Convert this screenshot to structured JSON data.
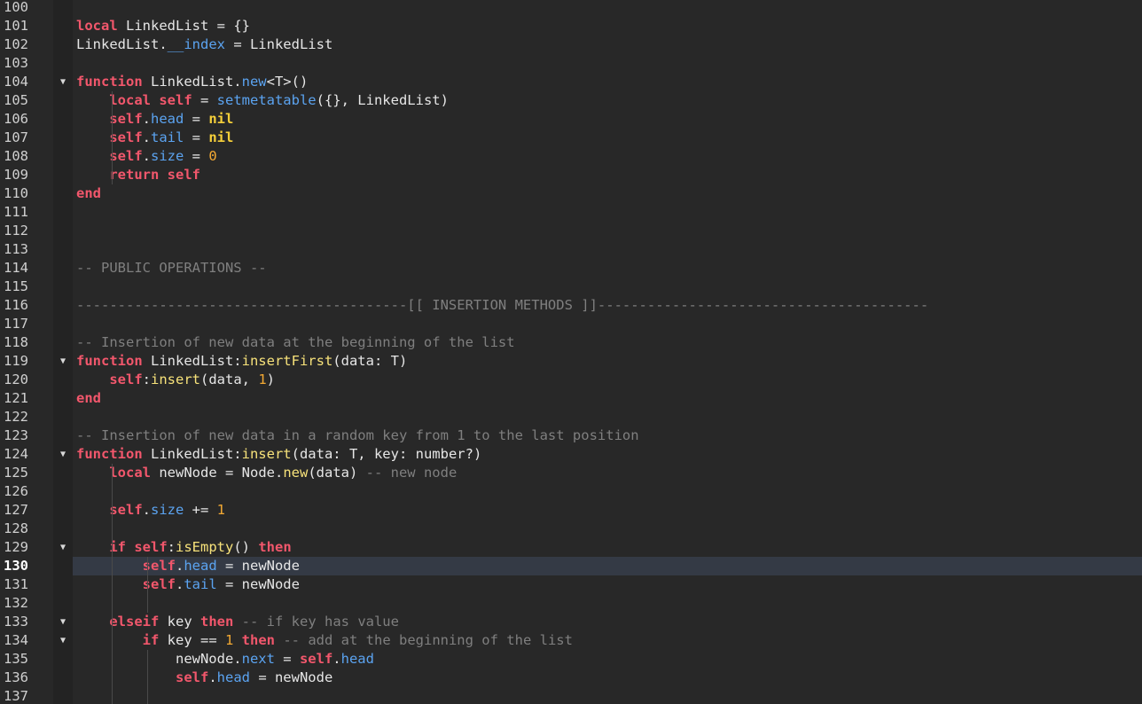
{
  "editor": {
    "first_line": 100,
    "active_line": 130,
    "fold_marker_icon": "fold-caret-icon",
    "colors": {
      "background": "#282828",
      "keyword": "#f2576c",
      "comment": "#7f7f7f",
      "function": "#f7e27a",
      "property": "#5ba3f0",
      "number": "#f3a933",
      "constant": "#f5cf3a",
      "text": "#e6e6e6",
      "active_line": "#343a45"
    },
    "lines": [
      {
        "num": "100",
        "fold": false,
        "tokens": []
      },
      {
        "num": "101",
        "fold": false,
        "tokens": [
          [
            "kw",
            "local"
          ],
          [
            "pl",
            " LinkedList = {}"
          ]
        ]
      },
      {
        "num": "102",
        "fold": false,
        "tokens": [
          [
            "pl",
            "LinkedList."
          ],
          [
            "pr",
            "__index"
          ],
          [
            "pl",
            " = LinkedList"
          ]
        ]
      },
      {
        "num": "103",
        "fold": false,
        "tokens": []
      },
      {
        "num": "104",
        "fold": true,
        "tokens": [
          [
            "kw",
            "function"
          ],
          [
            "pl",
            " LinkedList."
          ],
          [
            "pr",
            "new"
          ],
          [
            "pl",
            "<T>()"
          ]
        ]
      },
      {
        "num": "105",
        "fold": false,
        "tokens": [
          [
            "pl",
            "    "
          ],
          [
            "kw",
            "local self"
          ],
          [
            "pl",
            " = "
          ],
          [
            "pr",
            "setmetatable"
          ],
          [
            "pl",
            "({}, LinkedList)"
          ]
        ]
      },
      {
        "num": "106",
        "fold": false,
        "tokens": [
          [
            "pl",
            "    "
          ],
          [
            "kw",
            "self"
          ],
          [
            "pl",
            "."
          ],
          [
            "pr",
            "head"
          ],
          [
            "pl",
            " = "
          ],
          [
            "cs",
            "nil"
          ]
        ]
      },
      {
        "num": "107",
        "fold": false,
        "tokens": [
          [
            "pl",
            "    "
          ],
          [
            "kw",
            "self"
          ],
          [
            "pl",
            "."
          ],
          [
            "pr",
            "tail"
          ],
          [
            "pl",
            " = "
          ],
          [
            "cs",
            "nil"
          ]
        ]
      },
      {
        "num": "108",
        "fold": false,
        "tokens": [
          [
            "pl",
            "    "
          ],
          [
            "kw",
            "self"
          ],
          [
            "pl",
            "."
          ],
          [
            "pr",
            "size"
          ],
          [
            "pl",
            " = "
          ],
          [
            "nu",
            "0"
          ]
        ]
      },
      {
        "num": "109",
        "fold": false,
        "tokens": [
          [
            "pl",
            "    "
          ],
          [
            "kw",
            "return self"
          ]
        ]
      },
      {
        "num": "110",
        "fold": false,
        "tokens": [
          [
            "kw",
            "end"
          ]
        ]
      },
      {
        "num": "111",
        "fold": false,
        "tokens": []
      },
      {
        "num": "112",
        "fold": false,
        "tokens": []
      },
      {
        "num": "113",
        "fold": false,
        "tokens": []
      },
      {
        "num": "114",
        "fold": false,
        "tokens": [
          [
            "cm",
            "-- PUBLIC OPERATIONS --"
          ]
        ]
      },
      {
        "num": "115",
        "fold": false,
        "tokens": []
      },
      {
        "num": "116",
        "fold": false,
        "tokens": [
          [
            "cm",
            "----------------------------------------[[ INSERTION METHODS ]]----------------------------------------"
          ]
        ]
      },
      {
        "num": "117",
        "fold": false,
        "tokens": []
      },
      {
        "num": "118",
        "fold": false,
        "tokens": [
          [
            "cm",
            "-- Insertion of new data at the beginning of the list"
          ]
        ]
      },
      {
        "num": "119",
        "fold": true,
        "tokens": [
          [
            "kw",
            "function"
          ],
          [
            "pl",
            " LinkedList:"
          ],
          [
            "fn",
            "insertFirst"
          ],
          [
            "pl",
            "(data: T)"
          ]
        ]
      },
      {
        "num": "120",
        "fold": false,
        "tokens": [
          [
            "pl",
            "    "
          ],
          [
            "kw",
            "self"
          ],
          [
            "pl",
            ":"
          ],
          [
            "fn",
            "insert"
          ],
          [
            "pl",
            "(data, "
          ],
          [
            "nu",
            "1"
          ],
          [
            "pl",
            ")"
          ]
        ]
      },
      {
        "num": "121",
        "fold": false,
        "tokens": [
          [
            "kw",
            "end"
          ]
        ]
      },
      {
        "num": "122",
        "fold": false,
        "tokens": []
      },
      {
        "num": "123",
        "fold": false,
        "tokens": [
          [
            "cm",
            "-- Insertion of new data in a random key from 1 to the last position"
          ]
        ]
      },
      {
        "num": "124",
        "fold": true,
        "tokens": [
          [
            "kw",
            "function"
          ],
          [
            "pl",
            " LinkedList:"
          ],
          [
            "fn",
            "insert"
          ],
          [
            "pl",
            "(data: T, key: number?)"
          ]
        ]
      },
      {
        "num": "125",
        "fold": false,
        "tokens": [
          [
            "pl",
            "    "
          ],
          [
            "kw",
            "local"
          ],
          [
            "pl",
            " newNode = Node."
          ],
          [
            "fn",
            "new"
          ],
          [
            "pl",
            "(data) "
          ],
          [
            "cm",
            "-- new node"
          ]
        ]
      },
      {
        "num": "126",
        "fold": false,
        "tokens": []
      },
      {
        "num": "127",
        "fold": false,
        "tokens": [
          [
            "pl",
            "    "
          ],
          [
            "kw",
            "self"
          ],
          [
            "pl",
            "."
          ],
          [
            "pr",
            "size"
          ],
          [
            "pl",
            " += "
          ],
          [
            "nu",
            "1"
          ]
        ]
      },
      {
        "num": "128",
        "fold": false,
        "tokens": []
      },
      {
        "num": "129",
        "fold": true,
        "tokens": [
          [
            "pl",
            "    "
          ],
          [
            "kw",
            "if self"
          ],
          [
            "pl",
            ":"
          ],
          [
            "fn",
            "isEmpty"
          ],
          [
            "pl",
            "() "
          ],
          [
            "kw",
            "then"
          ]
        ]
      },
      {
        "num": "130",
        "fold": false,
        "tokens": [
          [
            "pl",
            "        "
          ],
          [
            "kw",
            "self"
          ],
          [
            "pl",
            "."
          ],
          [
            "pr",
            "head"
          ],
          [
            "pl",
            " = newNode"
          ]
        ]
      },
      {
        "num": "131",
        "fold": false,
        "tokens": [
          [
            "pl",
            "        "
          ],
          [
            "kw",
            "self"
          ],
          [
            "pl",
            "."
          ],
          [
            "pr",
            "tail"
          ],
          [
            "pl",
            " = newNode"
          ]
        ]
      },
      {
        "num": "132",
        "fold": false,
        "tokens": []
      },
      {
        "num": "133",
        "fold": true,
        "tokens": [
          [
            "pl",
            "    "
          ],
          [
            "kw",
            "elseif"
          ],
          [
            "pl",
            " key "
          ],
          [
            "kw",
            "then"
          ],
          [
            "pl",
            " "
          ],
          [
            "cm",
            "-- if key has value"
          ]
        ]
      },
      {
        "num": "134",
        "fold": true,
        "tokens": [
          [
            "pl",
            "        "
          ],
          [
            "kw",
            "if"
          ],
          [
            "pl",
            " key == "
          ],
          [
            "nu",
            "1"
          ],
          [
            "pl",
            " "
          ],
          [
            "kw",
            "then"
          ],
          [
            "pl",
            " "
          ],
          [
            "cm",
            "-- add at the beginning of the list"
          ]
        ]
      },
      {
        "num": "135",
        "fold": false,
        "tokens": [
          [
            "pl",
            "            newNode."
          ],
          [
            "pr",
            "next"
          ],
          [
            "pl",
            " = "
          ],
          [
            "kw",
            "self"
          ],
          [
            "pl",
            "."
          ],
          [
            "pr",
            "head"
          ]
        ]
      },
      {
        "num": "136",
        "fold": false,
        "tokens": [
          [
            "pl",
            "            "
          ],
          [
            "kw",
            "self"
          ],
          [
            "pl",
            "."
          ],
          [
            "pr",
            "head"
          ],
          [
            "pl",
            " = newNode"
          ]
        ]
      },
      {
        "num": "137",
        "fold": false,
        "tokens": []
      }
    ]
  }
}
